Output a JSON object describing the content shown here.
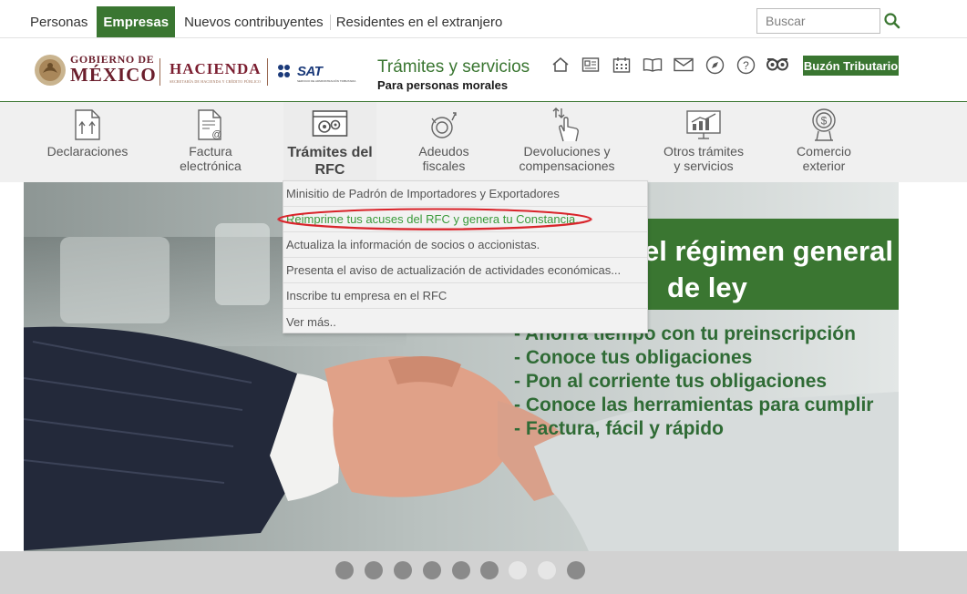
{
  "top_nav": {
    "items": [
      {
        "label": "Personas",
        "active": false
      },
      {
        "label": "Empresas",
        "active": true
      },
      {
        "label": "Nuevos contribuyentes",
        "active": false
      },
      {
        "label": "Residentes en el extranjero",
        "active": false
      }
    ]
  },
  "search": {
    "placeholder": "Buscar",
    "icon": "search-icon"
  },
  "header": {
    "gob_line1": "GOBIERNO DE",
    "gob_line2": "MÉXICO",
    "hacienda": "HACIENDA",
    "hacienda_sub": "SECRETARÍA DE HACIENDA Y CRÉDITO PÚBLICO",
    "sat": "SAT",
    "sat_sub": "SERVICIO DE ADMINISTRACIÓN TRIBUTARIA",
    "title": "Trámites y servicios",
    "subtitle": "Para personas morales",
    "icons": [
      "home-icon",
      "news-icon",
      "calendar-icon",
      "book-icon",
      "mail-icon",
      "compass-icon",
      "help-icon",
      "owl-icon"
    ],
    "buzon_label": "Buzón Tributario"
  },
  "categories": [
    {
      "label": "Declaraciones",
      "icon": "declaraciones-icon",
      "active": false
    },
    {
      "label": "Factura electrónica",
      "icon": "factura-icon",
      "active": false
    },
    {
      "label": "Trámites del RFC",
      "icon": "tramites-rfc-icon",
      "active": true
    },
    {
      "label": "Adeudos fiscales",
      "icon": "adeudos-icon",
      "active": false
    },
    {
      "label": "Devoluciones y compensaciones",
      "icon": "devoluciones-icon",
      "active": false
    },
    {
      "label": "Otros trámites y servicios",
      "icon": "otros-tramites-icon",
      "active": false
    },
    {
      "label": "Comercio exterior",
      "icon": "comercio-exterior-icon",
      "active": false
    }
  ],
  "dropdown": {
    "items": [
      {
        "label": "Minisitio de Padrón de Importadores y Exportadores",
        "highlighted": false
      },
      {
        "label": "Reimprime tus acuses del RFC y genera tu Constancia...",
        "highlighted": true
      },
      {
        "label": "Actualiza la información de socios o accionistas.",
        "highlighted": false
      },
      {
        "label": "Presenta el aviso de actualización de actividades económicas...",
        "highlighted": false
      },
      {
        "label": "Inscribe tu empresa en el RFC",
        "highlighted": false
      },
      {
        "label": "Ver más..",
        "highlighted": false
      }
    ]
  },
  "hero": {
    "banner_line1": "el régimen general",
    "banner_line2": "de ley",
    "bullets": [
      "- Ahorra tiempo con tu preinscripción",
      "- Conoce tus obligaciones",
      "- Pon al corriente tus obligaciones",
      "- Conoce las herramientas para cumplir",
      "- Factura, fácil y rápido"
    ]
  },
  "carousel": {
    "dots": [
      {
        "active": false
      },
      {
        "active": false
      },
      {
        "active": false
      },
      {
        "active": false
      },
      {
        "active": false
      },
      {
        "active": false
      },
      {
        "active": true
      },
      {
        "active": true
      },
      {
        "active": false
      }
    ]
  },
  "colors": {
    "brand_green": "#3a7631",
    "guinda": "#6b1e2c",
    "annotation_red": "#d9242b"
  }
}
